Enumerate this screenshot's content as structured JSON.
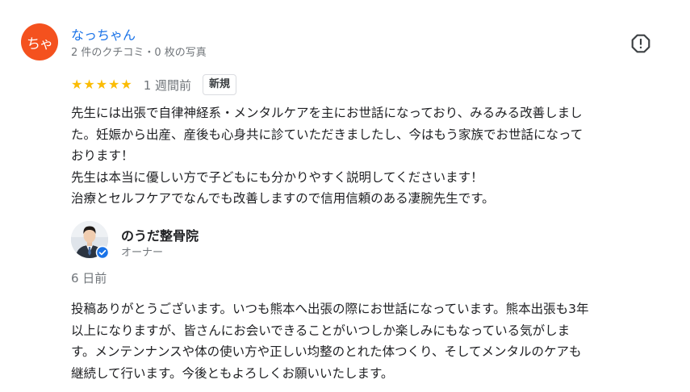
{
  "review": {
    "avatar_text": "ちゃ",
    "avatar_color": "#f4511e",
    "reviewer_name": "なっちゃん",
    "reviewer_meta": "2 件のクチコミ・0 枚の写真",
    "flag_icon": "report-flag-icon",
    "rating": 5,
    "stars": [
      "★",
      "★",
      "★",
      "★",
      "★"
    ],
    "date": "1 週間前",
    "badge": "新規",
    "text_lines": [
      "先生には出張で自律神経系・メンタルケアを主にお世話になっており、みるみる改善しまし",
      "た。妊娠から出産、産後も心身共に診ていただきましたし、今はもう家族でお世話になって",
      "おります！",
      "先生は本当に優しい方で子どもにも分かりやすく説明してくださいます！",
      "治療とセルフケアでなんでも改善しますので信用信頼のある凄腕先生です。"
    ]
  },
  "owner_reply": {
    "owner_name": "のうだ整骨院",
    "role": "オーナー",
    "verified_icon": "verified-check-icon",
    "date": "6 日前",
    "text_lines": [
      "投稿ありがとうございます。いつも熊本へ出張の際にお世話になっています。熊本出張も3年",
      "以上になりますが、皆さんにお会いできることがいつしか楽しみにもなっている気がしま",
      "す。メンテンナンスや体の使い方や正しい均整のとれた体つくり、そしてメンタルのケアも",
      "継続して行います。今後ともよろしくお願いいたします。"
    ]
  },
  "colors": {
    "star": "#fbbc04",
    "link": "#1a73e8",
    "meta": "#70757a",
    "verified": "#1a73e8"
  }
}
